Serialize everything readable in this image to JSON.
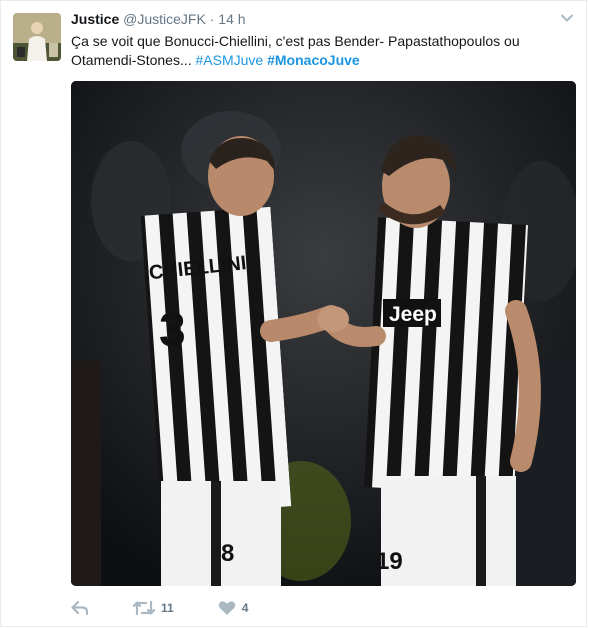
{
  "tweet": {
    "author_name": "Justice",
    "handle": "@JusticeJFK",
    "separator": "·",
    "time": "14 h",
    "text": "Ça se voit que Bonucci-Chiellini, c'est pas Bender- Papastathopoulos ou Otamendi-Stones...",
    "hashtag_1": "#ASMJuve",
    "hashtag_2": "#MonacoJuve",
    "retweet_count": "11",
    "like_count": "4"
  },
  "media": {
    "jersey_name": "CHIELLINI",
    "jersey_number_left": "3",
    "sponsor": "Jeep",
    "jersey_number_right": "19"
  },
  "colors": {
    "link": "#1b95e0",
    "muted": "#657786",
    "text": "#14171a",
    "border": "#e6ecf0"
  },
  "icons": [
    "chevron-down-icon",
    "reply-icon",
    "retweet-icon",
    "like-icon"
  ]
}
